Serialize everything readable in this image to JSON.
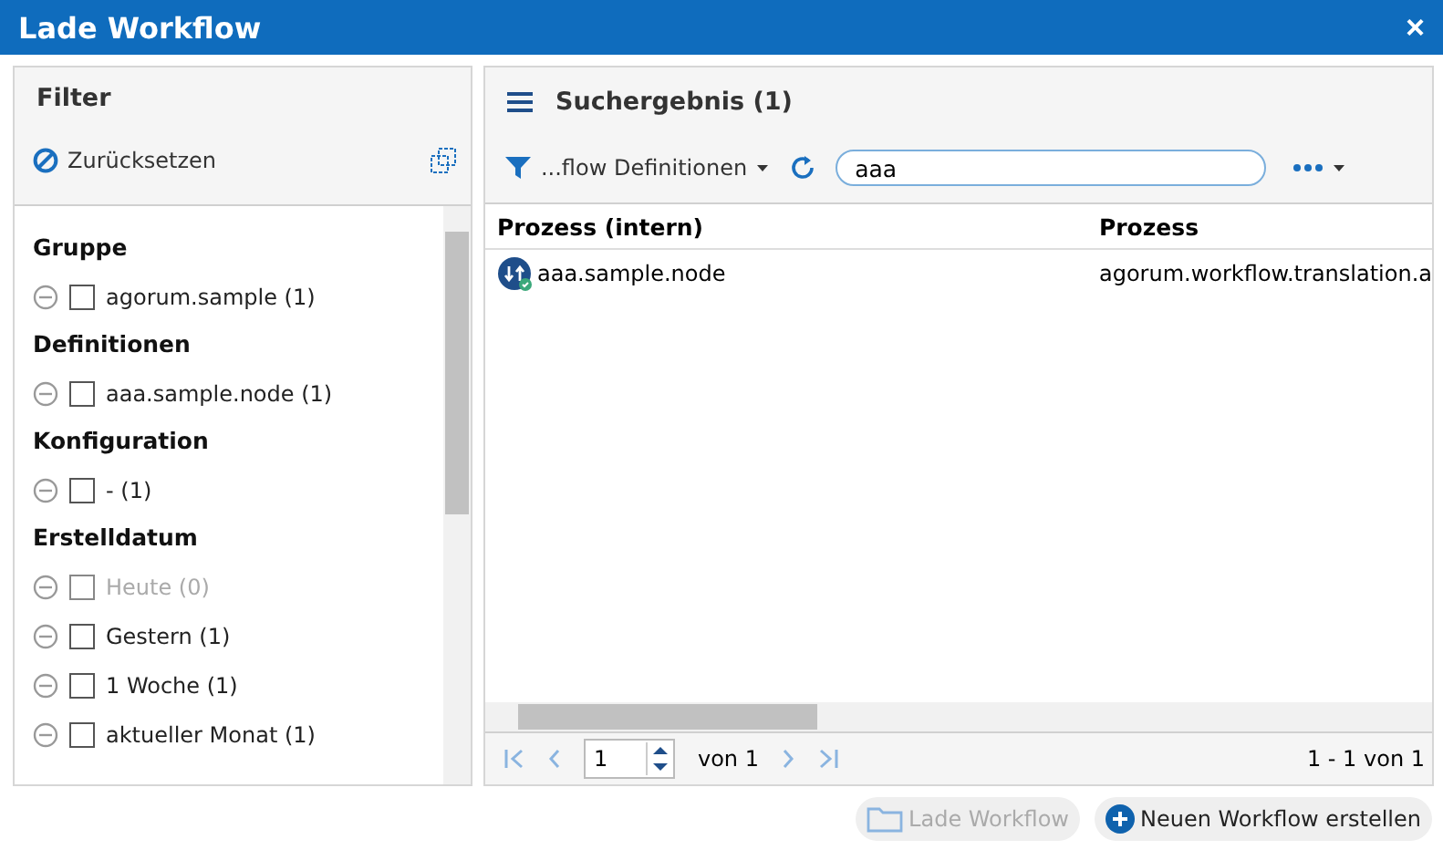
{
  "window": {
    "title": "Lade Workflow",
    "close": "×"
  },
  "filter": {
    "title": "Filter",
    "reset": "Zurücksetzen",
    "groups": [
      {
        "title": "Gruppe",
        "items": [
          {
            "label": "agorum.sample (1)",
            "checked": false,
            "disabled": false
          }
        ]
      },
      {
        "title": "Definitionen",
        "items": [
          {
            "label": "aaa.sample.node (1)",
            "checked": false,
            "disabled": false
          }
        ]
      },
      {
        "title": "Konfiguration",
        "items": [
          {
            "label": "- (1)",
            "checked": false,
            "disabled": false
          }
        ]
      },
      {
        "title": "Erstelldatum",
        "items": [
          {
            "label": "Heute (0)",
            "checked": false,
            "disabled": true
          },
          {
            "label": "Gestern (1)",
            "checked": false,
            "disabled": false
          },
          {
            "label": "1 Woche (1)",
            "checked": false,
            "disabled": false
          },
          {
            "label": "aktueller Monat (1)",
            "checked": false,
            "disabled": false
          }
        ]
      }
    ]
  },
  "results": {
    "title": "Suchergebnis (1)",
    "filter_dropdown": "...flow Definitionen",
    "search": {
      "value": "aaa"
    },
    "table": {
      "columns": [
        "Prozess (intern)",
        "Prozess"
      ],
      "rows": [
        {
          "cells": [
            "aaa.sample.node",
            "agorum.workflow.translation.a"
          ]
        }
      ]
    },
    "pager": {
      "page": "1",
      "of": "von 1",
      "summary": "1 - 1 von 1"
    }
  },
  "buttons": [
    {
      "label": "Lade Workflow",
      "kind": "load",
      "disabled": true
    },
    {
      "label": "Neuen Workflow erstellen",
      "kind": "create",
      "disabled": false
    }
  ]
}
